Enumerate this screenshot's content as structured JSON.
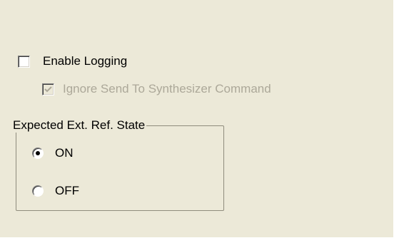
{
  "options": {
    "enable_logging": {
      "label": "Enable Logging",
      "checked": false
    },
    "ignore_send": {
      "label": "Ignore Send To Synthesizer Command",
      "checked": true,
      "disabled": true
    }
  },
  "ref_state_group": {
    "title": "Expected Ext. Ref. State",
    "options": [
      {
        "label": "ON",
        "selected": true
      },
      {
        "label": "OFF",
        "selected": false
      }
    ]
  },
  "colors": {
    "panel_background": "#ece9d8",
    "disabled_text": "#aca899"
  }
}
